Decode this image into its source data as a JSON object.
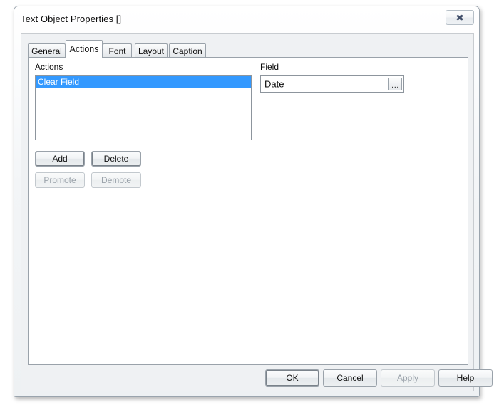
{
  "window": {
    "title": "Text Object Properties []",
    "close_button_label": "✖",
    "close_icon_name": "close-icon"
  },
  "tabs": [
    {
      "label": "General",
      "active": false
    },
    {
      "label": "Actions",
      "active": true
    },
    {
      "label": "Font",
      "active": false
    },
    {
      "label": "Layout",
      "active": false
    },
    {
      "label": "Caption",
      "active": false
    }
  ],
  "actions_panel": {
    "actions_group_label": "Actions",
    "list_items": [
      {
        "label": "Clear Field",
        "selected": true
      }
    ],
    "buttons": [
      {
        "label": "Add",
        "enabled": true
      },
      {
        "label": "Delete",
        "enabled": true
      },
      {
        "label": "Promote",
        "enabled": false
      },
      {
        "label": "Demote",
        "enabled": false
      }
    ],
    "field_group_label": "Field",
    "field_value": "Date",
    "field_placeholder": "",
    "browse_button_label": "...",
    "browse_icon_name": "ellipsis-icon"
  },
  "footer": {
    "buttons": [
      {
        "label": "OK",
        "enabled": true
      },
      {
        "label": "Cancel",
        "enabled": true
      },
      {
        "label": "Apply",
        "enabled": false
      },
      {
        "label": "Help",
        "enabled": true
      }
    ]
  },
  "colors": {
    "selection_blue": "#3399ff",
    "dialog_face": "#eff1f3",
    "panel_white": "#ffffff",
    "border_grey": "#9aa2aa",
    "disabled_text": "#9ba3ab"
  }
}
